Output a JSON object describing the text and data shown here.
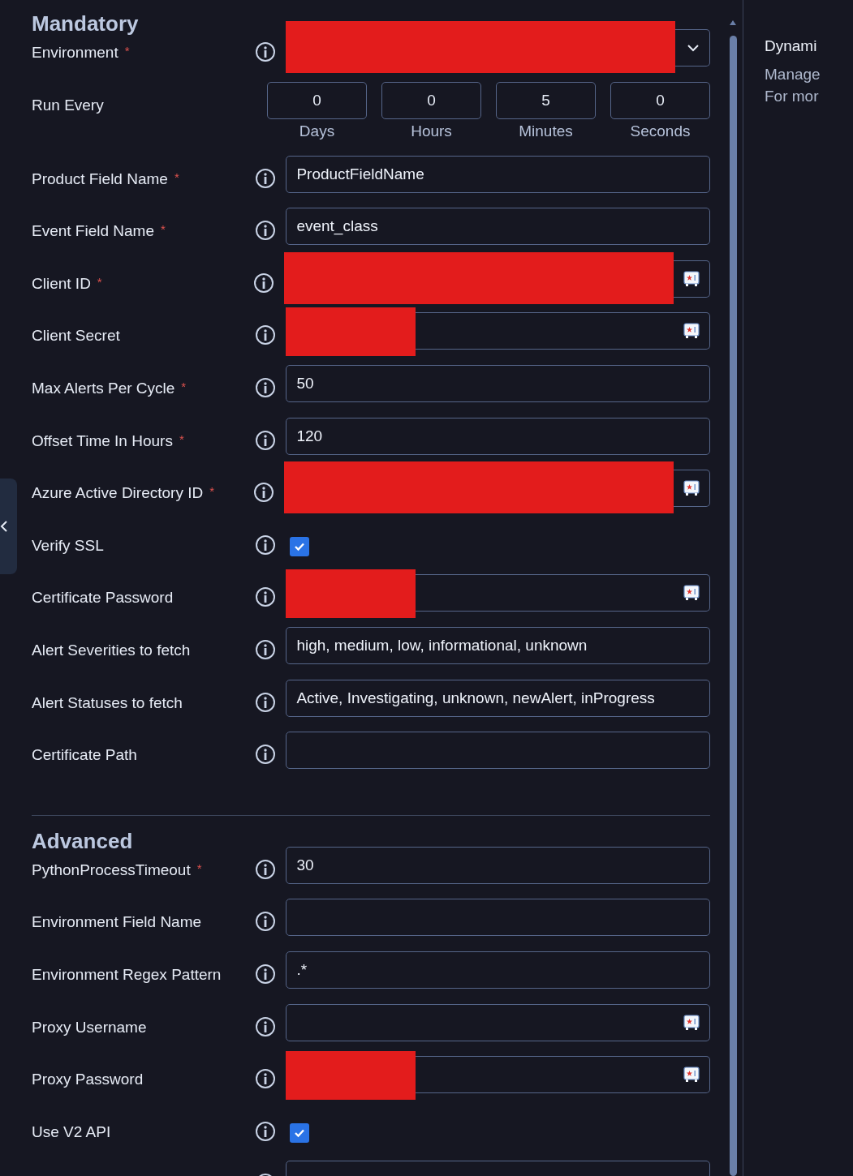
{
  "sections": [
    {
      "title": "Mandatory",
      "fields": [
        {
          "label": "Environment",
          "marker": "*",
          "info": true,
          "kind": "select",
          "redacted": true
        },
        {
          "label": "Run Every",
          "info": false,
          "kind": "duration",
          "parts": [
            {
              "value": "0",
              "unit": "Days"
            },
            {
              "value": "0",
              "unit": "Hours"
            },
            {
              "value": "5",
              "unit": "Minutes"
            },
            {
              "value": "0",
              "unit": "Seconds"
            }
          ]
        },
        {
          "label": "Product Field Name",
          "marker": "*",
          "info": true,
          "kind": "text",
          "value": "ProductFieldName"
        },
        {
          "label": "Event Field Name",
          "marker": "*",
          "info": true,
          "kind": "text",
          "value": "event_class"
        },
        {
          "label": "Client ID",
          "marker": "*",
          "info": true,
          "kind": "secret",
          "redacted": true
        },
        {
          "label": "Client Secret",
          "info": true,
          "kind": "secret",
          "redacted": true
        },
        {
          "label": "Max Alerts Per Cycle",
          "marker": "*",
          "info": true,
          "kind": "text",
          "value": "50"
        },
        {
          "label": "Offset Time In Hours",
          "marker": "*",
          "info": true,
          "kind": "text",
          "value": "120"
        },
        {
          "label": "Azure Active Directory ID",
          "marker": "*",
          "info": true,
          "kind": "secret",
          "redacted": true
        },
        {
          "label": "Verify SSL",
          "info": true,
          "kind": "checkbox",
          "checked": true
        },
        {
          "label": "Certificate Password",
          "info": true,
          "kind": "secret",
          "redacted": true
        },
        {
          "label": "Alert Severities to fetch",
          "info": true,
          "kind": "text",
          "value": "high, medium, low, informational, unknown"
        },
        {
          "label": "Alert Statuses to fetch",
          "info": true,
          "kind": "text",
          "value": "Active, Investigating, unknown, newAlert, inProgress"
        },
        {
          "label": "Certificate Path",
          "info": true,
          "kind": "text"
        }
      ]
    },
    {
      "title": "Advanced",
      "fields": [
        {
          "label": "PythonProcessTimeout",
          "marker": "*",
          "info": true,
          "kind": "text",
          "value": "30"
        },
        {
          "label": "Environment Field Name",
          "info": true,
          "kind": "text"
        },
        {
          "label": "Environment Regex Pattern",
          "info": true,
          "kind": "text",
          "value": ".*"
        },
        {
          "label": "Proxy Username",
          "info": true,
          "kind": "secret"
        },
        {
          "label": "Proxy Password",
          "info": true,
          "kind": "secret",
          "redacted": true
        },
        {
          "label": "Use V2 API",
          "info": true,
          "kind": "checkbox",
          "checked": true
        },
        {
          "info": true,
          "kind": "text"
        }
      ]
    }
  ],
  "side_panel": {
    "title": "Dynami",
    "lines": [
      "Manage",
      "For mor"
    ]
  }
}
